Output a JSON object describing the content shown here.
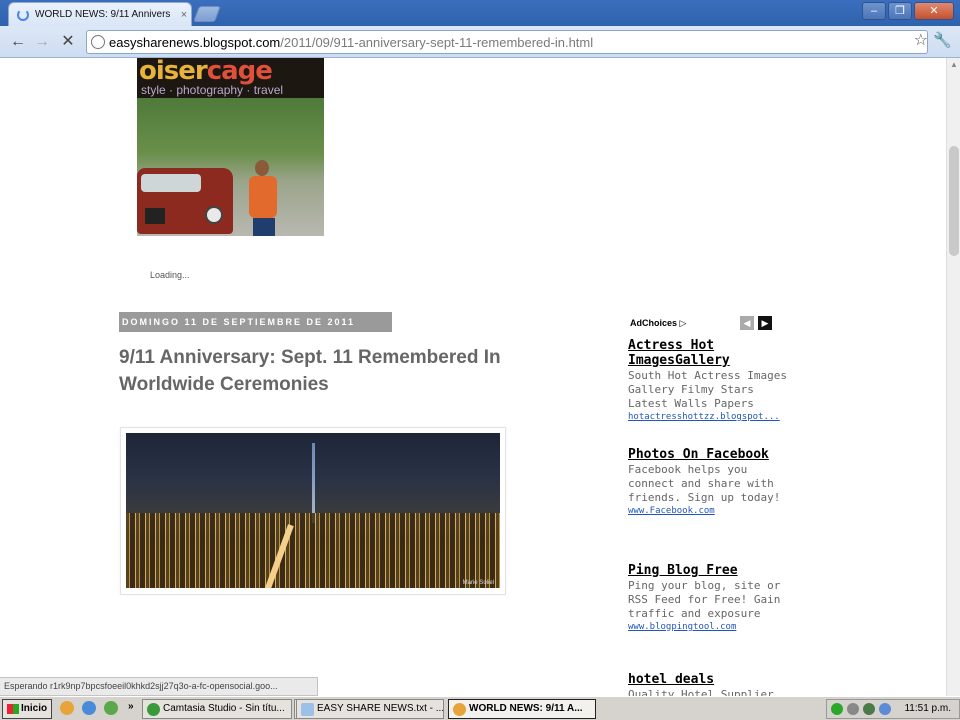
{
  "browser": {
    "tab_title": "WORLD NEWS: 9/11 Annivers",
    "tab_close": "×",
    "url_host": "easysharenews.blogspot.com",
    "url_path": "/2011/09/911-anniversary-sept-11-remembered-in.html",
    "window_buttons": [
      "–",
      "❐",
      "✕"
    ]
  },
  "page": {
    "banner": {
      "logo_first": "oiser",
      "logo_second": "cage",
      "tagline": "style · photography · travel"
    },
    "loading_text": "Loading...",
    "date_header": "domingo 11 de septiembre de 2011",
    "post_title": "9/11 Anniversary: Sept. 11 Remembered In Worldwide Ceremonies",
    "photo_credit": "Marie Soliel"
  },
  "ads": {
    "adchoices_label": "AdChoices ▷",
    "items": [
      {
        "title": "Actress Hot ImagesGallery",
        "text": "South Hot Actress Images Gallery Filmy Stars Latest Walls Papers",
        "url": "hotactresshottzz.blogspot..."
      },
      {
        "title": "Photos On Facebook",
        "text": "Facebook helps you connect and share with friends. Sign up today!",
        "url": "www.Facebook.com"
      },
      {
        "title": "Ping Blog Free",
        "text": "Ping your blog, site or RSS Feed for Free! Gain traffic and exposure",
        "url": "www.blogpingtool.com"
      },
      {
        "title": "hotel deals",
        "text": "Quality Hotel Supplier",
        "url": ""
      }
    ]
  },
  "status_bar": {
    "text": "Esperando r1rk9np7bpcsfoeeil0khkd2sjj27q3o-a-fc-opensocial.goo..."
  },
  "taskbar": {
    "start_label": "Inicio",
    "overflow": "»",
    "tasks": [
      {
        "label": "Camtasia Studio - Sin títu...",
        "active": false
      },
      {
        "label": "",
        "active": false
      },
      {
        "label": "EASY SHARE NEWS.txt - ...",
        "active": false
      },
      {
        "label": "WORLD NEWS: 9/11 A...",
        "active": true
      }
    ],
    "clock": "11:51 p.m."
  },
  "colors": {
    "chrome_blue": "#2f62ad",
    "date_badge": "#9a9a9a",
    "ad_link": "#2255bb",
    "post_title": "#666666"
  }
}
